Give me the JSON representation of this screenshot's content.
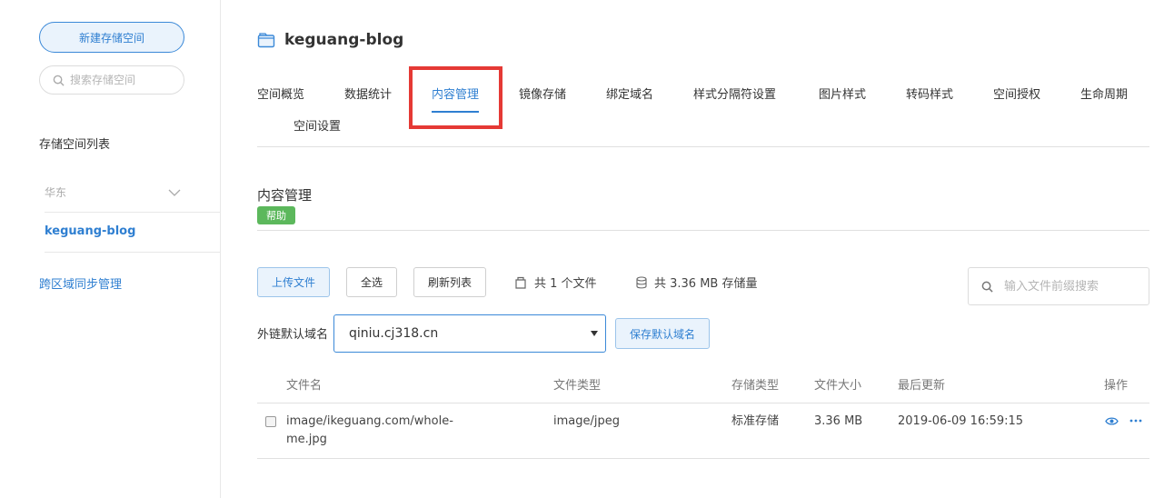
{
  "sidebar": {
    "new_bucket_label": "新建存储空间",
    "search_placeholder": "搜索存储空间",
    "list_heading": "存储空间列表",
    "region": "华东",
    "bucket_name": "keguang-blog",
    "cross_region_label": "跨区域同步管理"
  },
  "header": {
    "bucket_title": "keguang-blog"
  },
  "tabs": [
    {
      "label": "空间概览"
    },
    {
      "label": "数据统计"
    },
    {
      "label": "内容管理"
    },
    {
      "label": "镜像存储"
    },
    {
      "label": "绑定域名"
    },
    {
      "label": "样式分隔符设置"
    },
    {
      "label": "图片样式"
    },
    {
      "label": "转码样式"
    },
    {
      "label": "空间授权"
    },
    {
      "label": "生命周期"
    },
    {
      "label": "空间设置"
    }
  ],
  "active_tab": "内容管理",
  "content": {
    "title": "内容管理",
    "help_label": "帮助",
    "upload_label": "上传文件",
    "select_all_label": "全选",
    "refresh_label": "刷新列表",
    "file_count_text": "共 1 个文件",
    "storage_text": "共 3.36 MB 存储量",
    "search_placeholder": "输入文件前缀搜索",
    "domain_label": "外链默认域名",
    "domain_value": "qiniu.cj318.cn",
    "save_domain_label": "保存默认域名"
  },
  "table": {
    "headers": {
      "name": "文件名",
      "type": "文件类型",
      "storage": "存储类型",
      "size": "文件大小",
      "updated": "最后更新",
      "ops": "操作"
    },
    "rows": [
      {
        "name_line1": "image/ikeguang.com/whole-",
        "name_line2": "me.jpg",
        "type": "image/jpeg",
        "storage": "标准存储",
        "size": "3.36 MB",
        "updated": "2019-06-09 16:59:15"
      }
    ]
  },
  "colors": {
    "accent": "#2f7fd1",
    "help_badge": "#5cb85c",
    "highlight": "#e53935"
  }
}
